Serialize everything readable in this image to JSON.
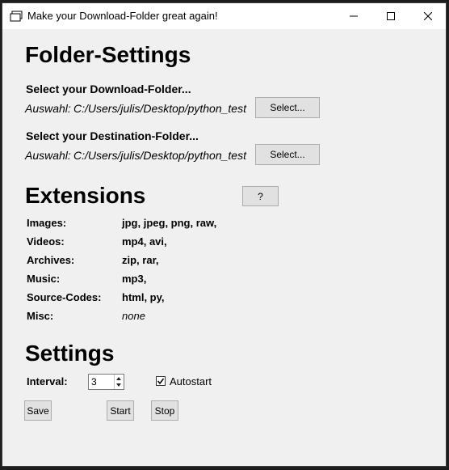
{
  "window": {
    "title": "Make your Download-Folder great again!"
  },
  "folder_settings": {
    "heading": "Folder-Settings",
    "download": {
      "label": "Select your Download-Folder...",
      "prefix": "Auswahl:",
      "path": "C:/Users/julis/Desktop/python_test",
      "button": "Select..."
    },
    "destination": {
      "label": "Select your Destination-Folder...",
      "prefix": "Auswahl:",
      "path": "C:/Users/julis/Desktop/python_test",
      "button": "Select..."
    }
  },
  "extensions": {
    "heading": "Extensions",
    "help_button": "?",
    "rows": [
      {
        "category": "Images:",
        "value": "jpg, jpeg, png, raw,"
      },
      {
        "category": "Videos:",
        "value": "mp4, avi,"
      },
      {
        "category": "Archives:",
        "value": "zip, rar,"
      },
      {
        "category": "Music:",
        "value": "mp3,"
      },
      {
        "category": "Source-Codes:",
        "value": "html, py,"
      },
      {
        "category": "Misc:",
        "value": "none"
      }
    ]
  },
  "settings": {
    "heading": "Settings",
    "interval_label": "Interval:",
    "interval_value": "3",
    "autostart_label": "Autostart",
    "autostart_checked": true,
    "buttons": {
      "save": "Save",
      "start": "Start",
      "stop": "Stop"
    }
  },
  "icons": {
    "app": "folder-icon",
    "minimize": "minimize-icon",
    "maximize": "maximize-icon",
    "close": "close-icon",
    "check": "checkmark-icon"
  }
}
